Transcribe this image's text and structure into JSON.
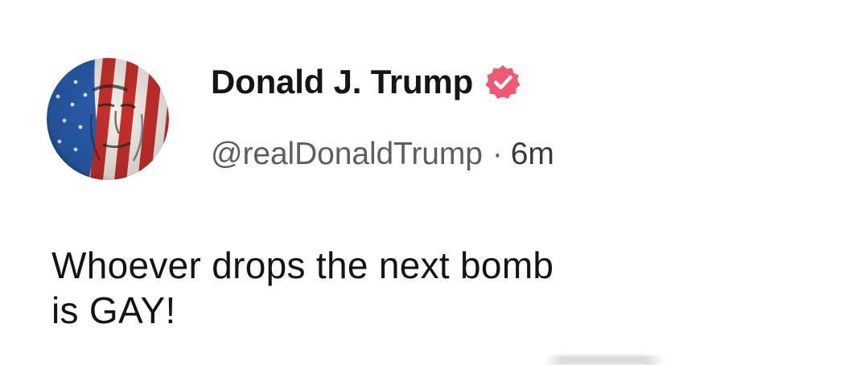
{
  "post": {
    "author": {
      "display_name": "Donald J. Trump",
      "handle": "@realDonaldTrump",
      "verified": true,
      "avatar_icon": "flag-portrait-avatar"
    },
    "separator": "·",
    "timestamp": "6m",
    "body_lines": [
      "Whoever drops the next bomb",
      "is GAY!"
    ]
  },
  "colors": {
    "verified_badge": "#ef5a73",
    "handle_text": "#5e5e60",
    "body_text": "#141414",
    "flag_red": "#c9302c",
    "flag_blue": "#2a5fb0"
  },
  "icons": {
    "verified": "verified-badge-icon"
  }
}
